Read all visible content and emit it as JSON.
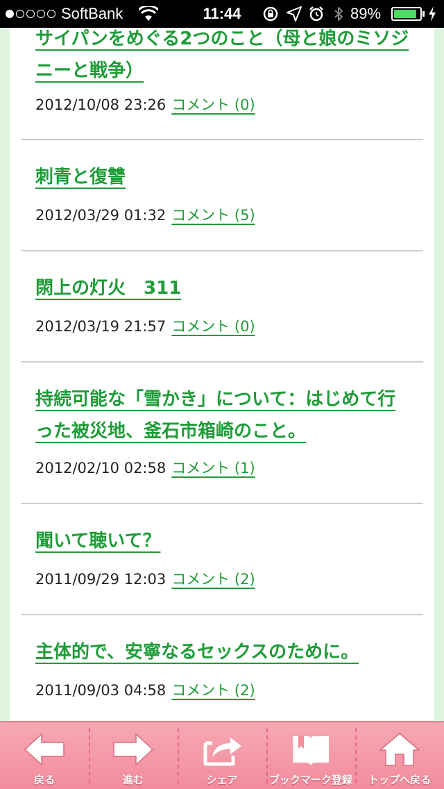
{
  "status_bar": {
    "carrier": "SoftBank",
    "time": "11:44",
    "battery": "89%",
    "battery_level": 0.89,
    "signal_bars": 1
  },
  "articles": [
    {
      "title": "サイパンをめぐる2つのこと（母と娘のミソジニーと戦争）",
      "datetime": "2012/10/08 23:26",
      "comments": "コメント (0)"
    },
    {
      "title": "刺青と復讐",
      "datetime": "2012/03/29 01:32",
      "comments": "コメント (5)"
    },
    {
      "title": "閖上の灯火　311",
      "datetime": "2012/03/19 21:57",
      "comments": "コメント (0)"
    },
    {
      "title": "持続可能な「雪かき」について：はじめて行った被災地、釜石市箱崎のこと。",
      "datetime": "2012/02/10 02:58",
      "comments": "コメント (1)"
    },
    {
      "title": "聞いて聴いて？",
      "datetime": "2011/09/29 12:03",
      "comments": "コメント (2)"
    },
    {
      "title": "主体的で、安寧なるセックスのために。",
      "datetime": "2011/09/03 04:58",
      "comments": "コメント (2)"
    }
  ],
  "toolbar": {
    "back": "戻る",
    "forward": "進む",
    "share": "シェア",
    "bookmark": "ブックマーク登録",
    "top": "トップへ戻る"
  },
  "colors": {
    "link_green": "#1e9c38",
    "toolbar_pink": "#f28c9c",
    "page_bg": "#dff5df"
  }
}
